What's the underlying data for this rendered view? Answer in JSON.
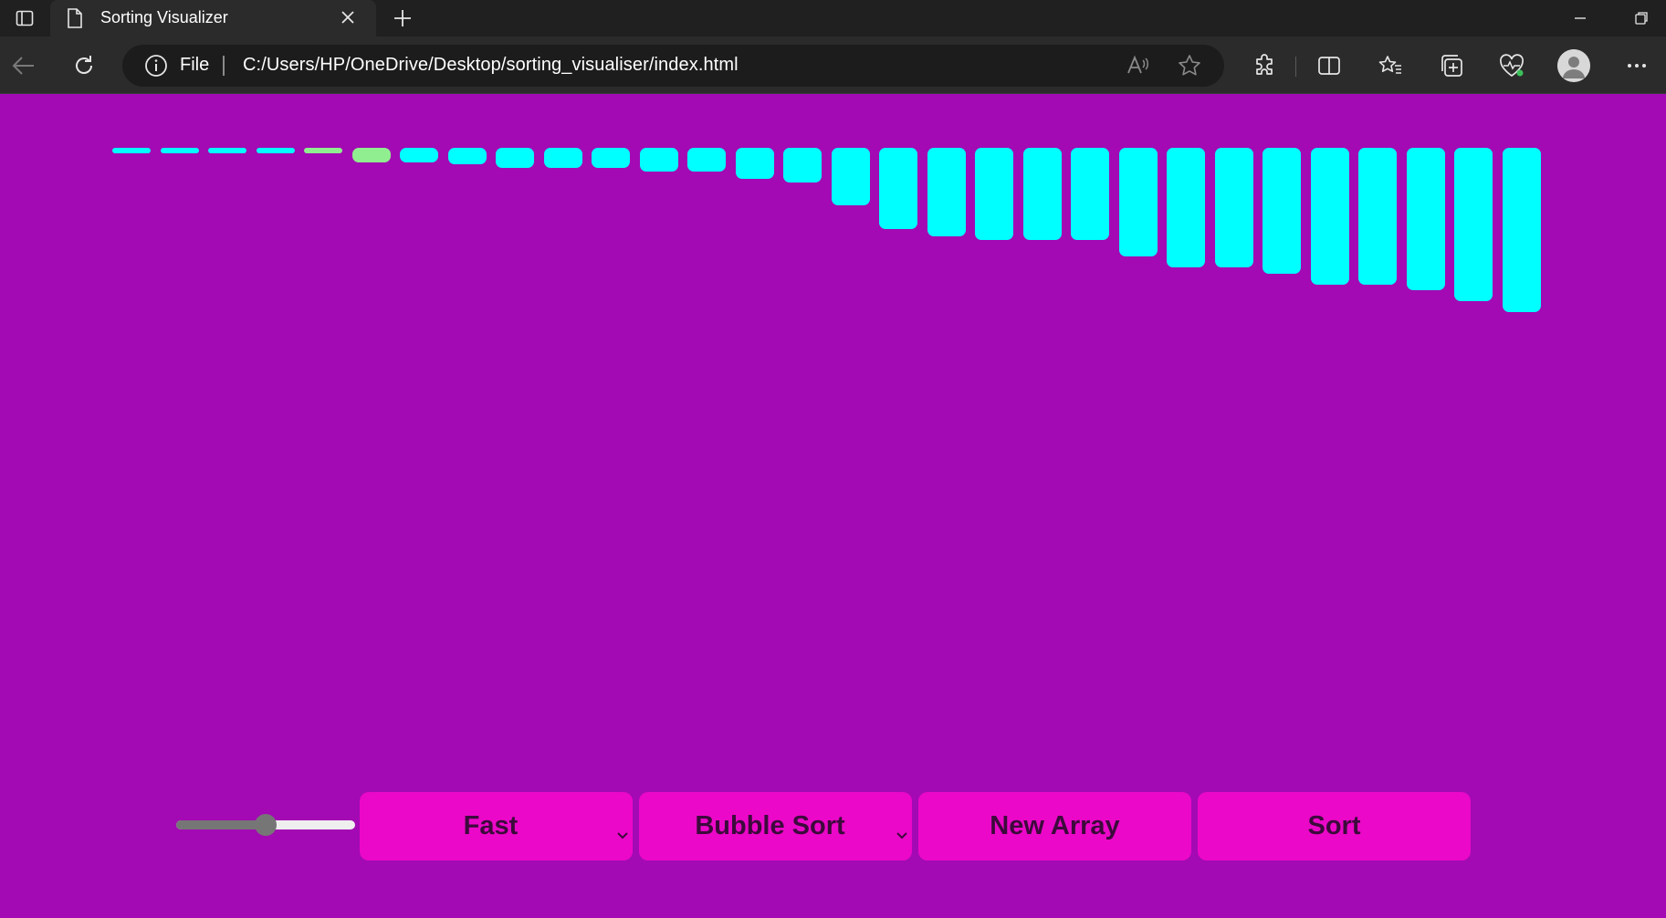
{
  "browser": {
    "tab_title": "Sorting Visualizer",
    "address_scheme": "File",
    "address_url": "C:/Users/HP/OneDrive/Desktop/sorting_visualiser/index.html"
  },
  "bars": {
    "values": [
      3,
      3,
      3,
      3,
      3,
      8,
      8,
      9,
      11,
      11,
      11,
      13,
      13,
      17,
      19,
      31,
      44,
      48,
      50,
      50,
      50,
      59,
      65,
      65,
      68,
      74,
      74,
      77,
      83,
      89
    ],
    "active_index": [
      4,
      5
    ],
    "colors": {
      "default": "#00ffff",
      "active": "#90ee90"
    }
  },
  "controls": {
    "speed_slider_value": 0.5,
    "speed_select": {
      "selected": "Fast"
    },
    "algorithm_select": {
      "selected": "Bubble Sort"
    },
    "new_array_label": "New Array",
    "sort_label": "Sort"
  },
  "colors": {
    "page_background": "#a30ab3",
    "button_background": "#ec08c8",
    "button_text": "#3c0a3c"
  }
}
